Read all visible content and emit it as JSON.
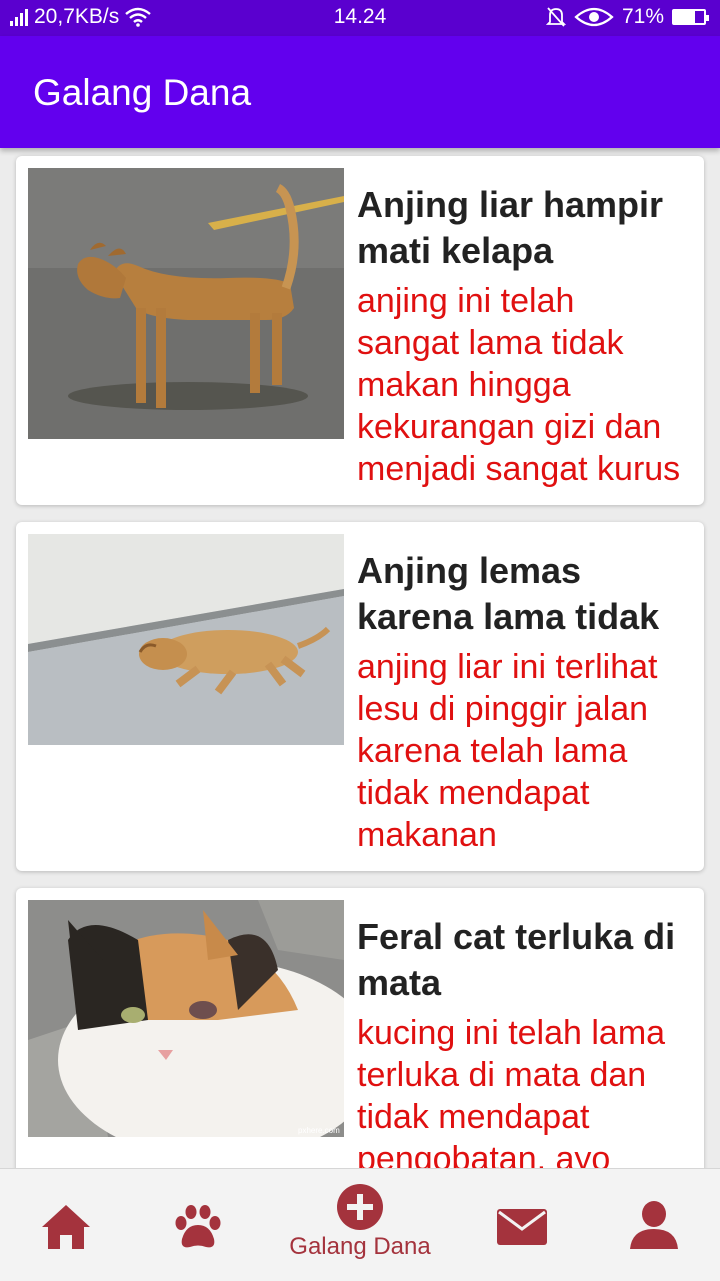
{
  "status_bar": {
    "speed": "20,7KB/s",
    "time": "14.24",
    "battery": "71%",
    "battery_level": 0.71,
    "icons": [
      "signal-icon",
      "wifi-icon",
      "mute-icon",
      "eye-icon",
      "battery-icon"
    ]
  },
  "app_bar": {
    "title": "Galang Dana"
  },
  "colors": {
    "status_bar": "#5a00cf",
    "app_bar": "#6200ee",
    "title_text": "#222222",
    "description_text": "#e01010",
    "nav_icon": "#a4333d"
  },
  "cards": [
    {
      "image": "stray-dog-standing",
      "title": "Anjing liar hampir mati kelapa",
      "description": "anjing ini telah sangat lama tidak makan hingga kekurangan gizi dan menjadi sangat kurus"
    },
    {
      "image": "dog-lying-on-road",
      "title": "Anjing lemas karena lama tidak",
      "description": "anjing liar ini terlihat lesu di pinggir jalan karena telah lama tidak mendapat makanan"
    },
    {
      "image": "injured-feral-cat",
      "title": "Feral cat terluka di mata",
      "description": "kucing ini telah lama terluka di mata dan tidak mendapat pengobatan, ayo"
    }
  ],
  "bottom_nav": {
    "items": [
      {
        "icon": "home-icon",
        "label": ""
      },
      {
        "icon": "paw-icon",
        "label": ""
      },
      {
        "icon": "add-circle-icon",
        "label": "Galang Dana",
        "active": true
      },
      {
        "icon": "mail-icon",
        "label": ""
      },
      {
        "icon": "profile-icon",
        "label": ""
      }
    ]
  }
}
